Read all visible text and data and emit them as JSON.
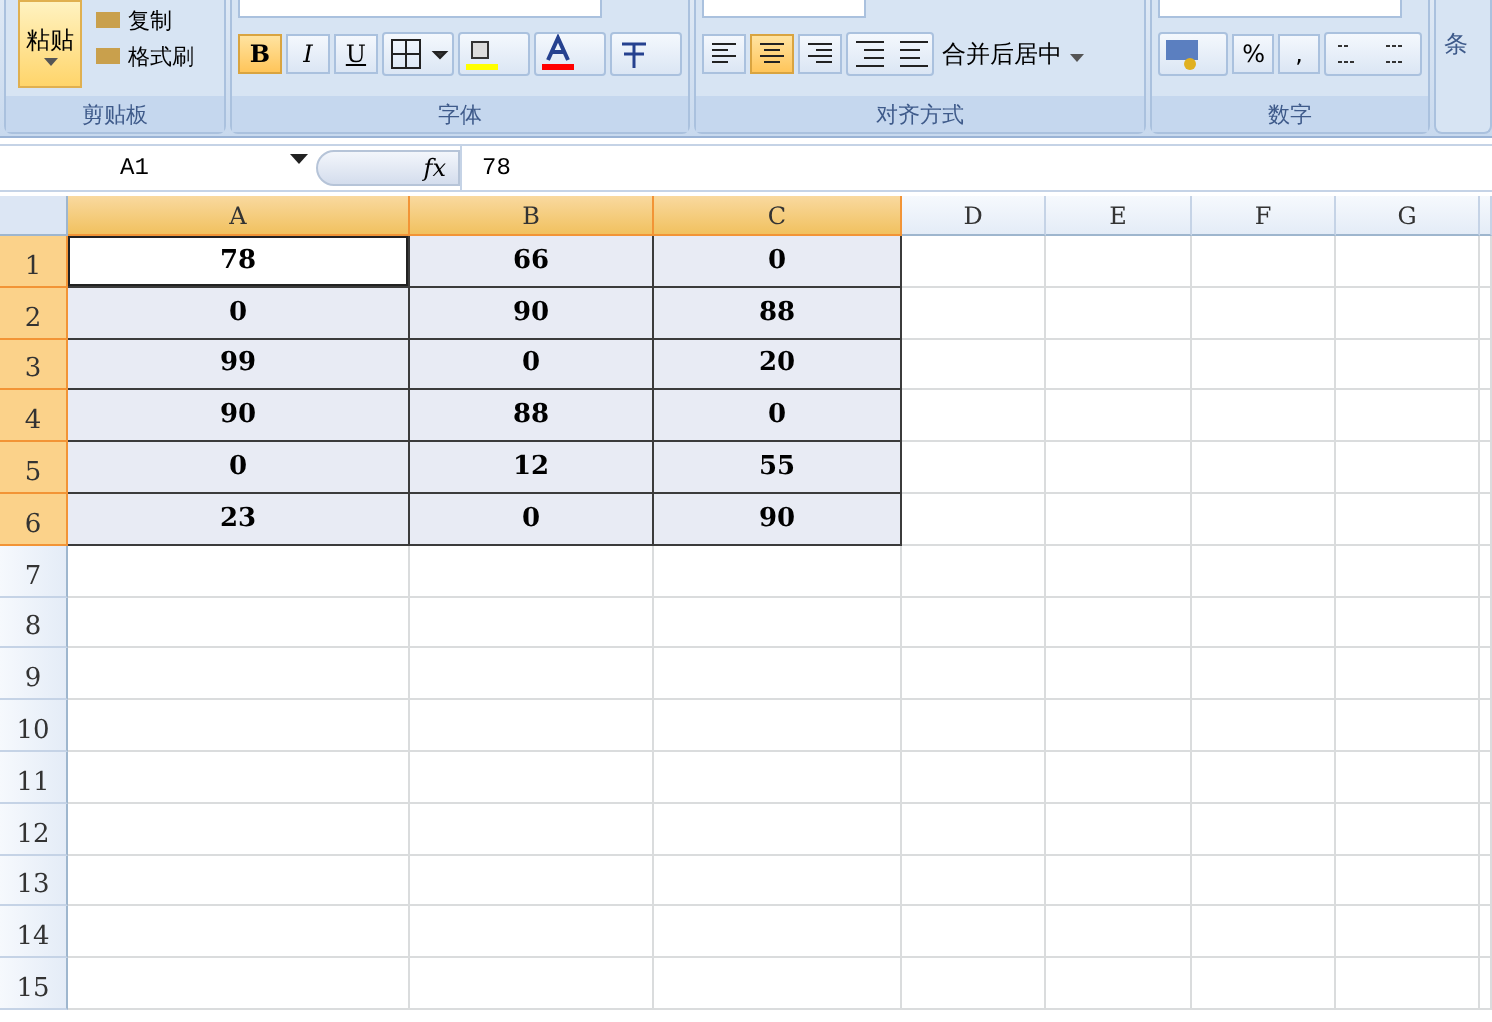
{
  "ribbon": {
    "groups": [
      {
        "kind": "clipboard",
        "title": "剪贴板",
        "paste": "粘贴",
        "items": [
          "复制",
          "格式刷"
        ]
      },
      {
        "kind": "font",
        "title": "字体",
        "buttons": [
          {
            "label": "B",
            "selected": true
          },
          {
            "label": "I",
            "selected": false
          },
          {
            "label": "U",
            "selected": false
          }
        ]
      },
      {
        "kind": "align",
        "title": "对齐方式",
        "aligns": [
          {
            "selected": false
          },
          {
            "selected": true
          },
          {
            "selected": false
          }
        ],
        "merge": "合并后居中"
      },
      {
        "kind": "number",
        "title": "数字",
        "buttons": [
          "%",
          ","
        ]
      },
      {
        "kind": "cut",
        "title": "条"
      }
    ]
  },
  "formula_bar": {
    "name_box": "A1",
    "fx": "fx",
    "value": "78"
  },
  "sheet": {
    "columns": [
      {
        "label": "A",
        "selected": true
      },
      {
        "label": "B",
        "selected": true
      },
      {
        "label": "C",
        "selected": true
      },
      {
        "label": "D",
        "selected": false
      },
      {
        "label": "E",
        "selected": false
      },
      {
        "label": "F",
        "selected": false
      },
      {
        "label": "G",
        "selected": false
      }
    ],
    "rows": [
      {
        "label": "1",
        "selected": true,
        "cells": [
          {
            "text": "78",
            "active": true
          },
          {
            "text": "66",
            "active": false
          },
          {
            "text": "0",
            "active": false
          }
        ]
      },
      {
        "label": "2",
        "selected": true,
        "cells": [
          {
            "text": "0",
            "active": false
          },
          {
            "text": "90",
            "active": false
          },
          {
            "text": "88",
            "active": false
          }
        ]
      },
      {
        "label": "3",
        "selected": true,
        "cells": [
          {
            "text": "99",
            "active": false
          },
          {
            "text": "0",
            "active": false
          },
          {
            "text": "20",
            "active": false
          }
        ]
      },
      {
        "label": "4",
        "selected": true,
        "cells": [
          {
            "text": "90",
            "active": false
          },
          {
            "text": "88",
            "active": false
          },
          {
            "text": "0",
            "active": false
          }
        ]
      },
      {
        "label": "5",
        "selected": true,
        "cells": [
          {
            "text": "0",
            "active": false
          },
          {
            "text": "12",
            "active": false
          },
          {
            "text": "55",
            "active": false
          }
        ]
      },
      {
        "label": "6",
        "selected": true,
        "cells": [
          {
            "text": "23",
            "active": false
          },
          {
            "text": "0",
            "active": false
          },
          {
            "text": "90",
            "active": false
          }
        ]
      },
      {
        "label": "7",
        "selected": false
      },
      {
        "label": "8",
        "selected": false
      },
      {
        "label": "9",
        "selected": false
      },
      {
        "label": "10",
        "selected": false
      },
      {
        "label": "11",
        "selected": false
      },
      {
        "label": "12",
        "selected": false
      },
      {
        "label": "13",
        "selected": false
      },
      {
        "label": "14",
        "selected": false
      },
      {
        "label": "15",
        "selected": false
      }
    ]
  }
}
